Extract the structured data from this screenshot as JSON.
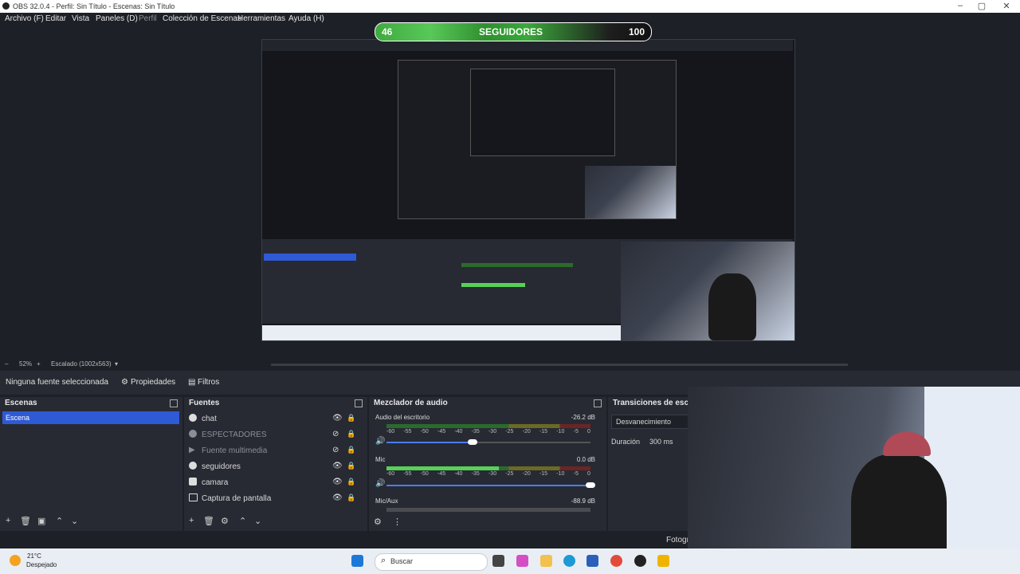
{
  "window": {
    "title": "OBS 32.0.4 - Perfil: Sin Título - Escenas: Sin Título"
  },
  "menu": [
    "Archivo (F)",
    "Editar",
    "Vista",
    "Paneles (D)",
    "Perfil",
    "Colección de Escenas",
    "Herramientas",
    "Ayuda (H)"
  ],
  "followers": {
    "current": "46",
    "label": "SEGUIDORES",
    "goal": "100",
    "progress": 0.46
  },
  "preview_status": {
    "zoom": "52%",
    "scale": "Escalado (1002x563)"
  },
  "source_bar": {
    "selection": "Ninguna fuente seleccionada",
    "properties": "Propiedades",
    "filters": "Filtros"
  },
  "scenes": {
    "title": "Escenas",
    "items": [
      "Escena"
    ]
  },
  "sources": {
    "title": "Fuentes",
    "items": [
      {
        "label": "chat",
        "visible": true
      },
      {
        "label": "ESPECTADORES",
        "visible": false
      },
      {
        "label": "Fuente multimedia",
        "visible": false
      },
      {
        "label": "seguidores",
        "visible": true
      },
      {
        "label": "camara",
        "visible": true
      },
      {
        "label": "Captura de pantalla",
        "visible": true
      }
    ]
  },
  "mixer": {
    "title": "Mezclador de audio",
    "channels": [
      {
        "name": "Audio del escritorio",
        "db": "-26.2 dB",
        "level": 0.0,
        "volume": 0.42
      },
      {
        "name": "Mic",
        "db": "0.0 dB",
        "level": 0.55,
        "volume": 1.0
      },
      {
        "name": "Mic/Aux",
        "db": "-88.9 dB",
        "level": 0.0,
        "volume": 0.0
      }
    ],
    "scale": [
      "-60",
      "-55",
      "-50",
      "-45",
      "-40",
      "-35",
      "-30",
      "-25",
      "-20",
      "-15",
      "-10",
      "-5",
      "0"
    ]
  },
  "transitions": {
    "title": "Transiciones de escena",
    "type": "Desvanecimiento",
    "duration_label": "Duración",
    "duration": "300 ms"
  },
  "status": {
    "right": "Fotogr"
  },
  "taskbar": {
    "weather_temp": "21°C",
    "weather_desc": "Despejado",
    "search": "Buscar"
  },
  "colors": {
    "accent": "#2f5ad6",
    "dock": "#272a33",
    "meter_green": "#57d157"
  }
}
